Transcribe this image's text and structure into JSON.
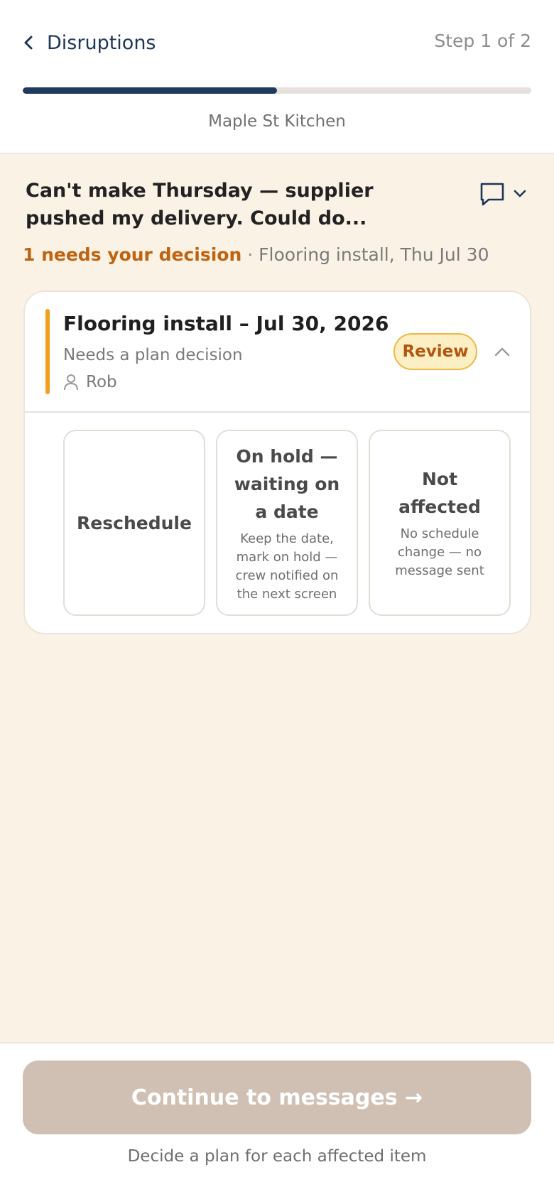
{
  "header": {
    "back_label": "Disruptions",
    "step_label": "Step 1 of 2",
    "progress": 0.5,
    "project_name": "Maple St Kitchen"
  },
  "message": {
    "preview": "Can't make Thursday — supplier pushed my delivery. Could do...",
    "toggle_icon": "chat-icon",
    "expand_icon": "chevron-down-icon"
  },
  "summary": {
    "decision_count": "1 needs your decision",
    "separator": "·",
    "detail": "Flooring install, Thu Jul 30"
  },
  "card": {
    "title": "Flooring install – Jul 30, 2026",
    "subtitle": "Needs a plan decision",
    "assignee": "Rob",
    "badge": "Review",
    "accent_color": "#f0a21e",
    "options": [
      {
        "title": "Reschedule",
        "description": ""
      },
      {
        "title": "On hold — waiting on a date",
        "description": "Keep the date, mark on hold — crew notified on the next screen"
      },
      {
        "title": "Not affected",
        "description": "No schedule change — no message sent"
      }
    ]
  },
  "footer": {
    "continue_label": "Continue to messages →",
    "hint": "Decide a plan for each affected item"
  },
  "colors": {
    "navy": "#1f3a5c",
    "page_background": "#faf2e5",
    "warning_text": "#c0620f",
    "button_disabled": "#d0c0b3"
  }
}
